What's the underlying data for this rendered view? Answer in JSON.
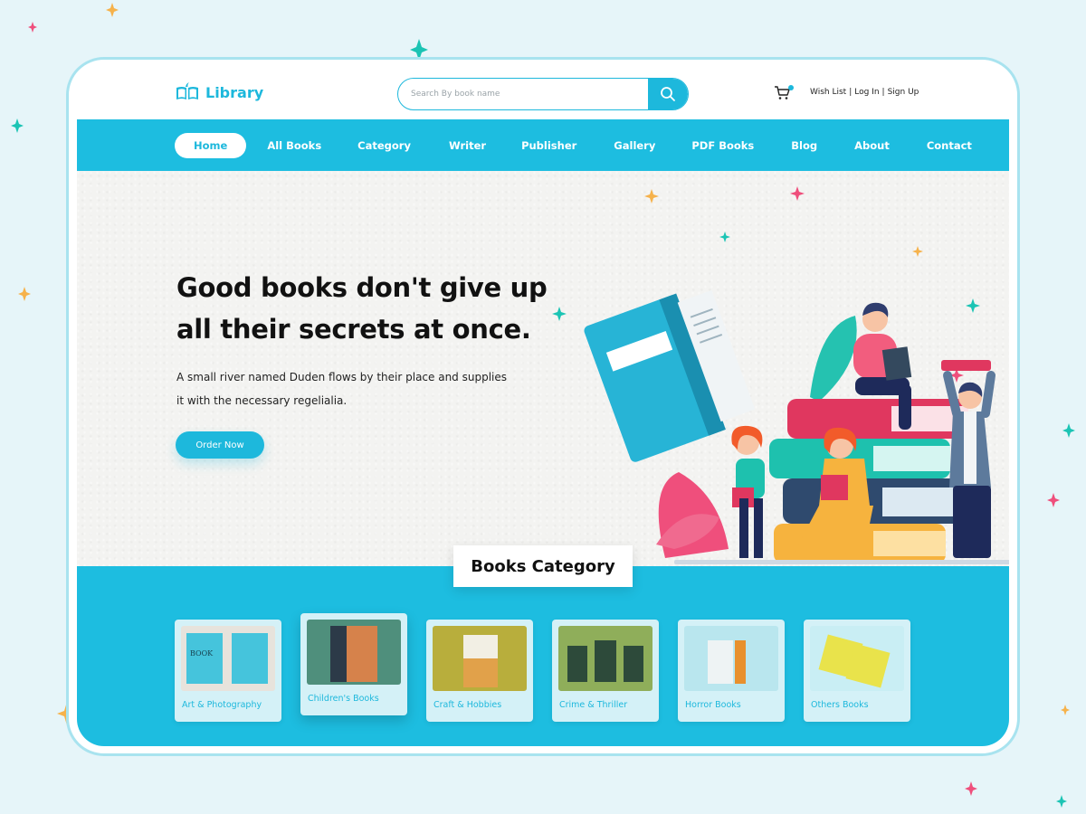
{
  "brand": {
    "name": "Library",
    "accent": "#1db8dc"
  },
  "search": {
    "placeholder": "Search By book name"
  },
  "account": {
    "wishlist": "Wish List",
    "login": "Log In",
    "signup": "Sign Up",
    "separator": "|"
  },
  "nav": {
    "items": [
      {
        "label": "Home",
        "active": true
      },
      {
        "label": "All Books"
      },
      {
        "label": "Category"
      },
      {
        "label": "Writer"
      },
      {
        "label": "Publisher"
      },
      {
        "label": "Gallery"
      },
      {
        "label": "PDF Books"
      },
      {
        "label": "Blog"
      },
      {
        "label": "About"
      },
      {
        "label": "Contact"
      }
    ]
  },
  "hero": {
    "headline_line1": "Good books don't give up",
    "headline_line2": "all their secrets at once.",
    "subtext_line1": "A small river named Duden flows by their place and supplies",
    "subtext_line2": "it with the necessary regelialia.",
    "cta": "Order Now"
  },
  "categories": {
    "title": "Books Category",
    "items": [
      {
        "label": "Art & Photography"
      },
      {
        "label": "Children's Books"
      },
      {
        "label": "Craft & Hobbies"
      },
      {
        "label": "Crime & Thriller"
      },
      {
        "label": "Horror Books"
      },
      {
        "label": "Others Books"
      }
    ]
  },
  "icons": {
    "logo": "open-book-icon",
    "search": "search-icon",
    "cart": "cart-icon"
  }
}
